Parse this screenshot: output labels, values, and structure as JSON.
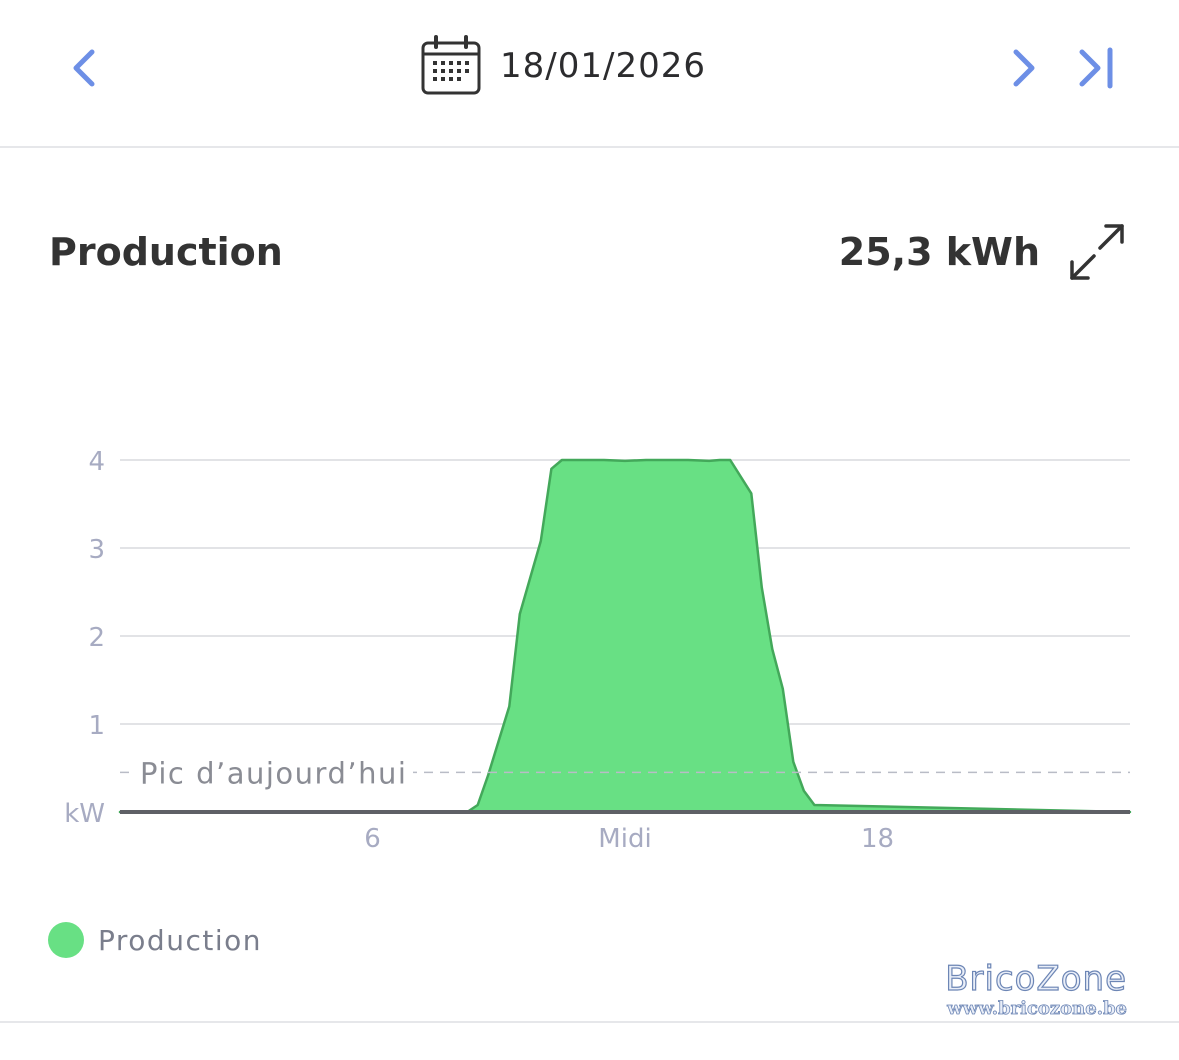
{
  "colors": {
    "accent": "#6d8fe6",
    "fill": "#68e084",
    "stroke": "#43a85a",
    "grid": "#d9dade",
    "axis_text": "#a7abc2"
  },
  "nav": {
    "prev_icon": "chevron-left-icon",
    "next_icon": "chevron-right-icon",
    "last_icon": "skip-to-end-icon",
    "calendar_icon": "calendar-icon",
    "date": "18/01/2026"
  },
  "card": {
    "title": "Production",
    "total": "25,3 kWh",
    "expand_icon": "expand-icon"
  },
  "legend": {
    "label": "Production"
  },
  "watermark": {
    "name": "BricoZone",
    "url": "www.bricozone.be"
  },
  "chart_data": {
    "type": "area",
    "title": "Production",
    "ylabel": "kW",
    "xlim": [
      0,
      24
    ],
    "ylim": [
      0,
      4
    ],
    "yticks": [
      1,
      2,
      3,
      4
    ],
    "xticks": [
      {
        "x": 6,
        "label": "6"
      },
      {
        "x": 12,
        "label": "Midi"
      },
      {
        "x": 18,
        "label": "18"
      }
    ],
    "reference_line": {
      "y": 0.45,
      "label": "Pic d’aujourd’hui"
    },
    "grid": true,
    "legend_position": "bottom-left",
    "series": [
      {
        "name": "Production",
        "x": [
          0,
          8.25,
          8.5,
          8.75,
          9.25,
          9.5,
          10.0,
          10.25,
          10.5,
          11.0,
          11.5,
          12.0,
          12.5,
          13.0,
          13.5,
          14.0,
          14.25,
          14.5,
          15.0,
          15.25,
          15.5,
          15.75,
          16.0,
          16.25,
          16.5,
          24
        ],
        "y": [
          0,
          0,
          0.08,
          0.42,
          1.2,
          2.25,
          3.08,
          3.9,
          4.0,
          4.0,
          4.0,
          3.99,
          4.0,
          4.0,
          4.0,
          3.99,
          4.0,
          4.0,
          3.62,
          2.55,
          1.85,
          1.4,
          0.57,
          0.24,
          0.08,
          0
        ]
      }
    ]
  }
}
